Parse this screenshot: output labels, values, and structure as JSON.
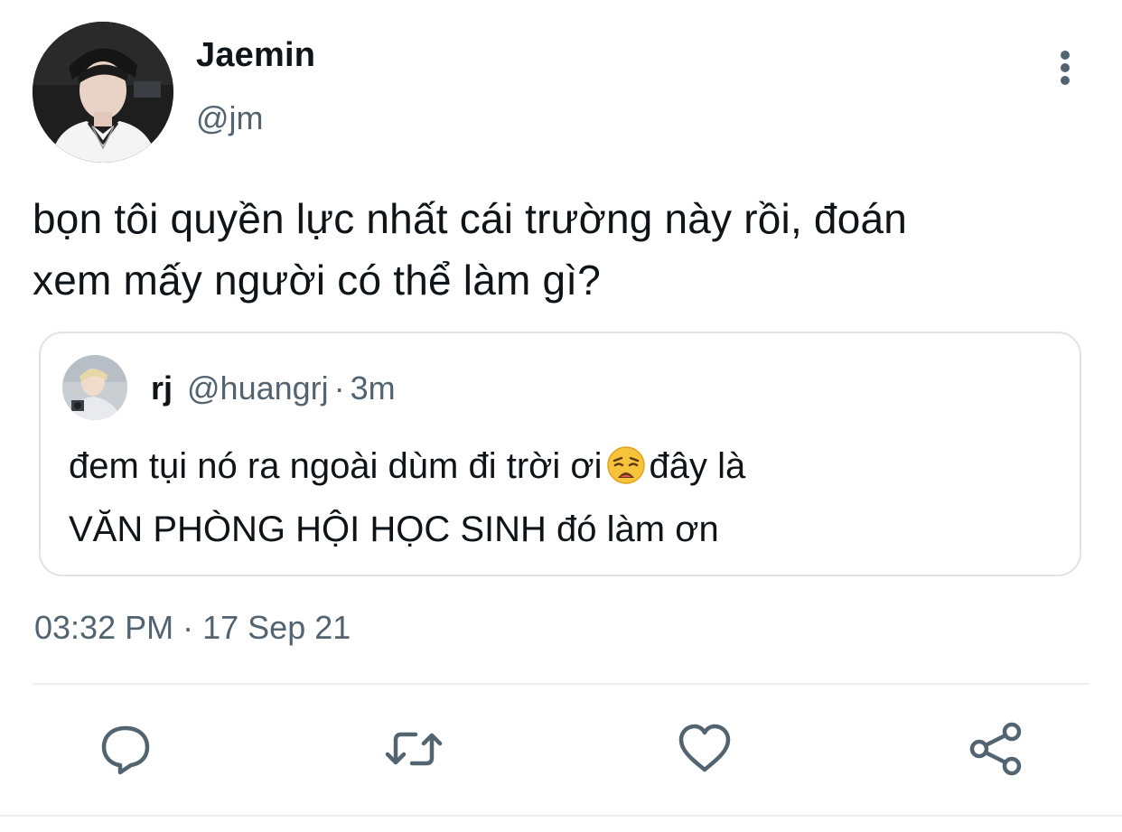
{
  "tweet": {
    "author": {
      "display_name": "Jaemin",
      "handle": "@jm"
    },
    "text_line1": "bọn tôi quyền lực nhất cái trường này rồi, đoán",
    "text_line2": "xem mấy người có thể làm gì?",
    "timestamp": {
      "time": "03:32 PM",
      "separator": "·",
      "date": "17 Sep 21"
    }
  },
  "quoted_tweet": {
    "author": {
      "display_name": "rj",
      "handle": "@huangrj"
    },
    "separator": "·",
    "age": "3m",
    "text_part1": "đem tụi nó ra ngoài dùm đi trời ơi",
    "emoji": "weary-face-emoji",
    "text_part2": "đây là",
    "text_line2": "VĂN PHÒNG HỘI HỌC SINH đó làm ơn"
  },
  "actions": {
    "icons": [
      "reply-icon",
      "retweet-icon",
      "like-icon",
      "share-icon"
    ]
  },
  "colors": {
    "primary_text": "#0f1419",
    "secondary_text": "#536471",
    "border": "#dfe3e7",
    "divider": "#eceff1"
  }
}
